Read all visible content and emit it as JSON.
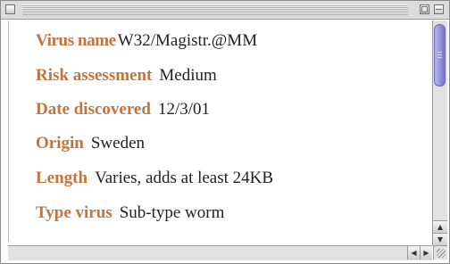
{
  "window": {
    "title": "",
    "accent_color": "#c4733b",
    "scroll_thumb_color": "#8e8edc"
  },
  "icons": {
    "close": "close-box-icon",
    "zoom": "zoom-box-icon",
    "collapse": "collapse-box-icon",
    "scroll_up": "arrow-up-icon",
    "scroll_down": "arrow-down-icon",
    "scroll_left": "arrow-left-icon",
    "scroll_right": "arrow-right-icon",
    "grow": "resize-grip-icon"
  },
  "fields": [
    {
      "label": "Virus name",
      "value": "W32/Magistr.@MM"
    },
    {
      "label": "Risk assessment",
      "value": "Medium"
    },
    {
      "label": "Date discovered",
      "value": "12/3/01"
    },
    {
      "label": "Origin",
      "value": "Sweden"
    },
    {
      "label": "Length",
      "value": "Varies, adds at least 24KB"
    },
    {
      "label": "Type virus",
      "value": "Sub-type worm"
    }
  ]
}
